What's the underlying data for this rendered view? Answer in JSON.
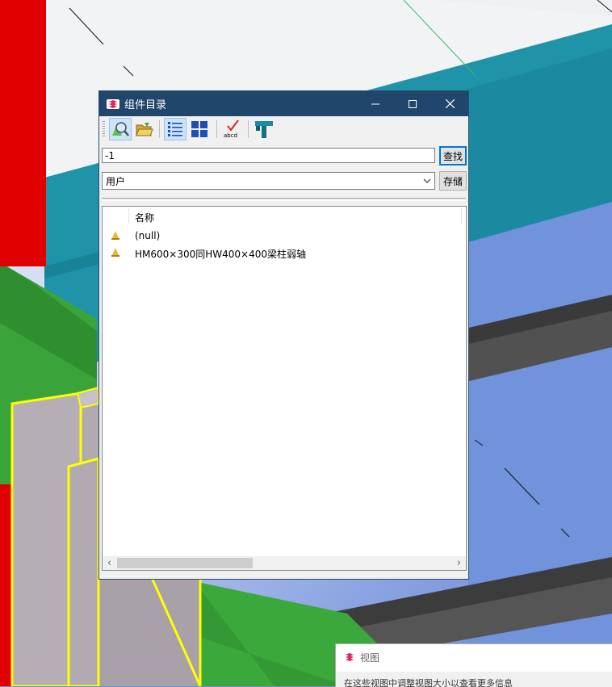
{
  "dialog": {
    "title": "组件目录",
    "search_value": "-1",
    "search_button": "查找",
    "filter_selected": "用户",
    "save_button": "存储",
    "list_header": "名称",
    "items": [
      {
        "label": "(null)",
        "icon": "component-cone-icon"
      },
      {
        "label": "HM600×300同HW400×400梁柱弱轴",
        "icon": "component-cone-icon"
      }
    ],
    "toolbar": [
      "search-catalog-icon",
      "open-folder-icon",
      "list-view-icon",
      "thumbnail-view-icon",
      "spell-check-icon",
      "t-beam-icon"
    ],
    "spell_icon_text": "abcd",
    "window_buttons": [
      "minimize",
      "maximize",
      "close"
    ]
  },
  "view_dialog": {
    "title": "视图",
    "body_text": "在这些视图中调整视图大小以查看更多信息"
  },
  "colors": {
    "titlebar": "#21466b",
    "accent": "#0078d7",
    "teal_structure": "#1c8aa0",
    "green_floor": "#3aa83a",
    "red_column": "#e00000",
    "sky_blue": "#6e8fd8"
  }
}
